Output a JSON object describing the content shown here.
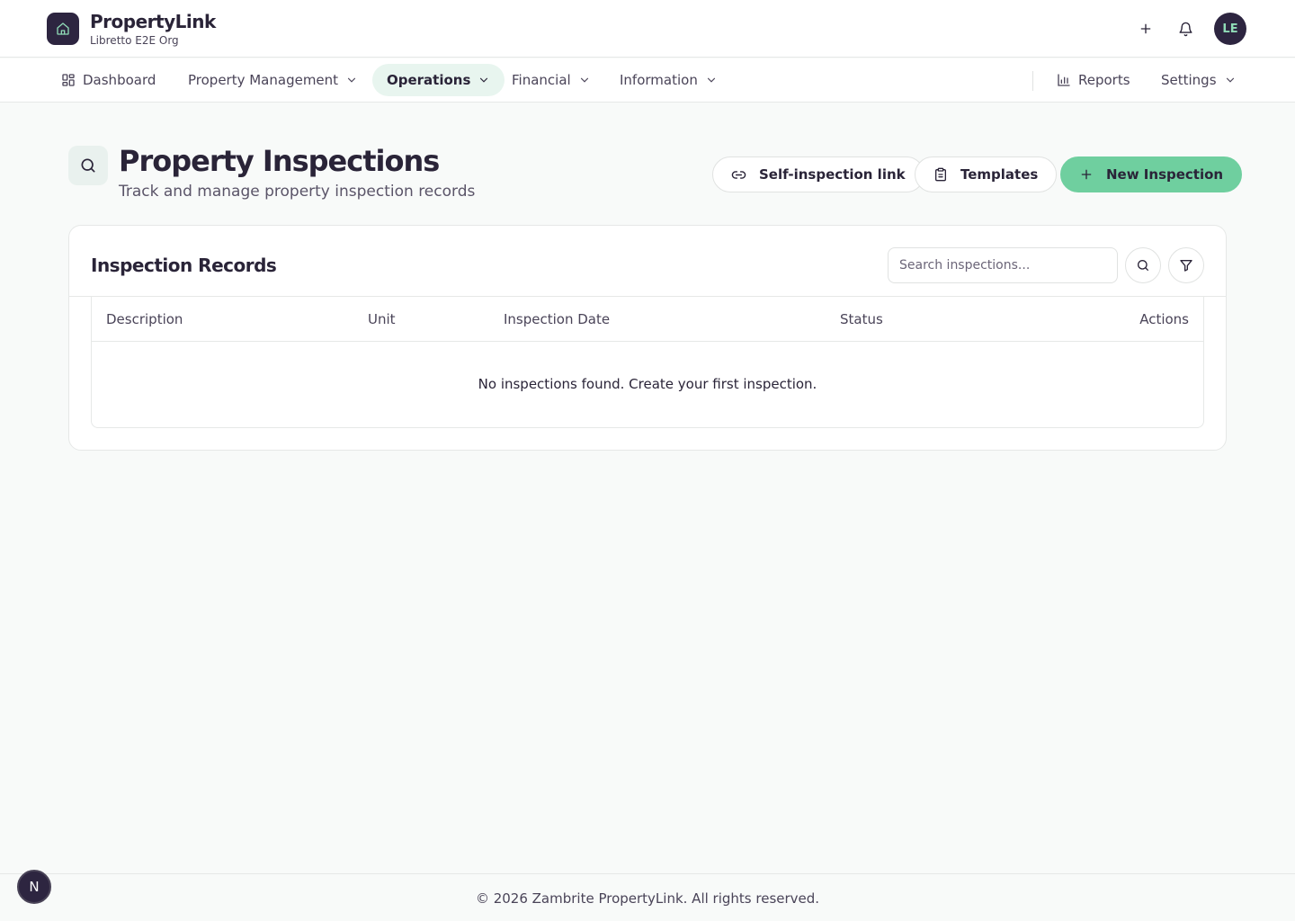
{
  "brand": {
    "name": "PropertyLink",
    "org": "Libretto E2E Org",
    "icon": "home-icon"
  },
  "topbar": {
    "add_icon": "plus-icon",
    "notifications_icon": "bell-icon",
    "avatar_initials": "LE"
  },
  "nav": {
    "items": [
      {
        "label": "Dashboard",
        "icon": "dashboard-grid-icon",
        "dropdown": false
      },
      {
        "label": "Property Management",
        "dropdown": true
      },
      {
        "label": "Operations",
        "dropdown": true,
        "active": true
      },
      {
        "label": "Financial",
        "dropdown": true
      },
      {
        "label": "Information",
        "dropdown": true
      }
    ],
    "right_items": [
      {
        "label": "Reports",
        "icon": "bar-chart-icon",
        "dropdown": false
      },
      {
        "label": "Settings",
        "dropdown": true
      }
    ]
  },
  "page": {
    "title": "Property Inspections",
    "subtitle": "Track and manage property inspection records",
    "icon": "search-icon",
    "actions": {
      "self_inspection": "Self-inspection link",
      "templates": "Templates",
      "new_inspection": "New Inspection"
    }
  },
  "records": {
    "title": "Inspection Records",
    "search_placeholder": "Search inspections...",
    "columns": [
      "Description",
      "Unit",
      "Inspection Date",
      "Status",
      "Actions"
    ],
    "empty_message": "No inspections found. Create your first inspection."
  },
  "footer": {
    "text": "© 2026 Zambrite PropertyLink. All rights reserved."
  },
  "dev_badge": {
    "label": "N"
  },
  "colors": {
    "brand_dark": "#2d2540",
    "accent_green": "#6fcf9f",
    "active_nav_bg": "#e8f5ef",
    "background": "#f8faf9"
  }
}
